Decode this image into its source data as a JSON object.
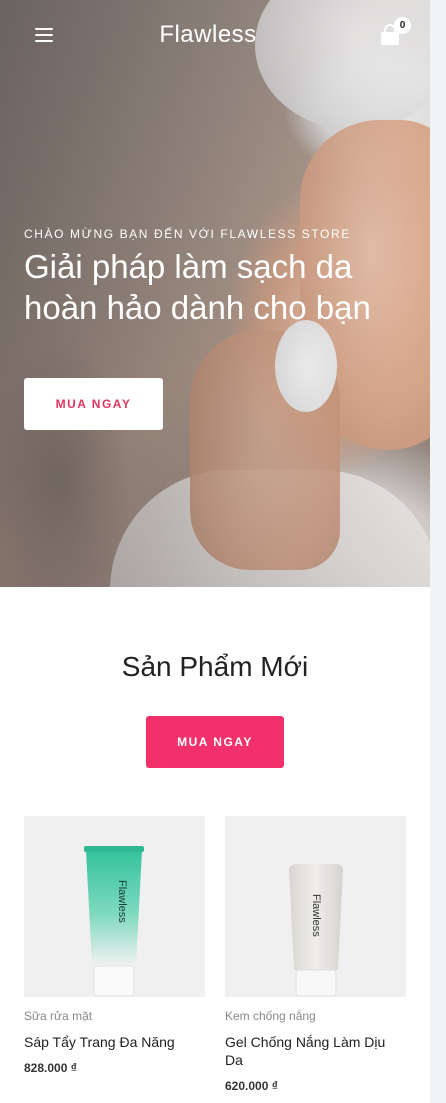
{
  "header": {
    "brand": "Flawless",
    "cart_count": "0",
    "menu_icon": "hamburger-menu-icon",
    "cart_icon": "shopping-bag-icon"
  },
  "hero": {
    "kicker": "CHÀO MỪNG BẠN ĐẾN VỚI FLAWLESS STORE",
    "title": "Giải pháp làm sạch da hoàn hảo dành cho bạn",
    "button_label": "MUA NGAY"
  },
  "new_products": {
    "title": "Sản Phẩm Mới",
    "button_label": "MUA NGAY",
    "items": [
      {
        "category": "Sữa rửa mặt",
        "name": "Sáp Tẩy Trang Đa Năng",
        "price": "828.000 ₫",
        "tube_label": "Flawless",
        "tube_color": "#3fc5a0"
      },
      {
        "category": "Kem chống nắng",
        "name": "Gel Chống Nắng Làm Dịu Da",
        "price": "620.000 ₫",
        "tube_label": "Flawless",
        "tube_color": "#e8e5e0"
      }
    ]
  },
  "colors": {
    "accent": "#f2306a",
    "hero_button_text": "#e2365f"
  }
}
